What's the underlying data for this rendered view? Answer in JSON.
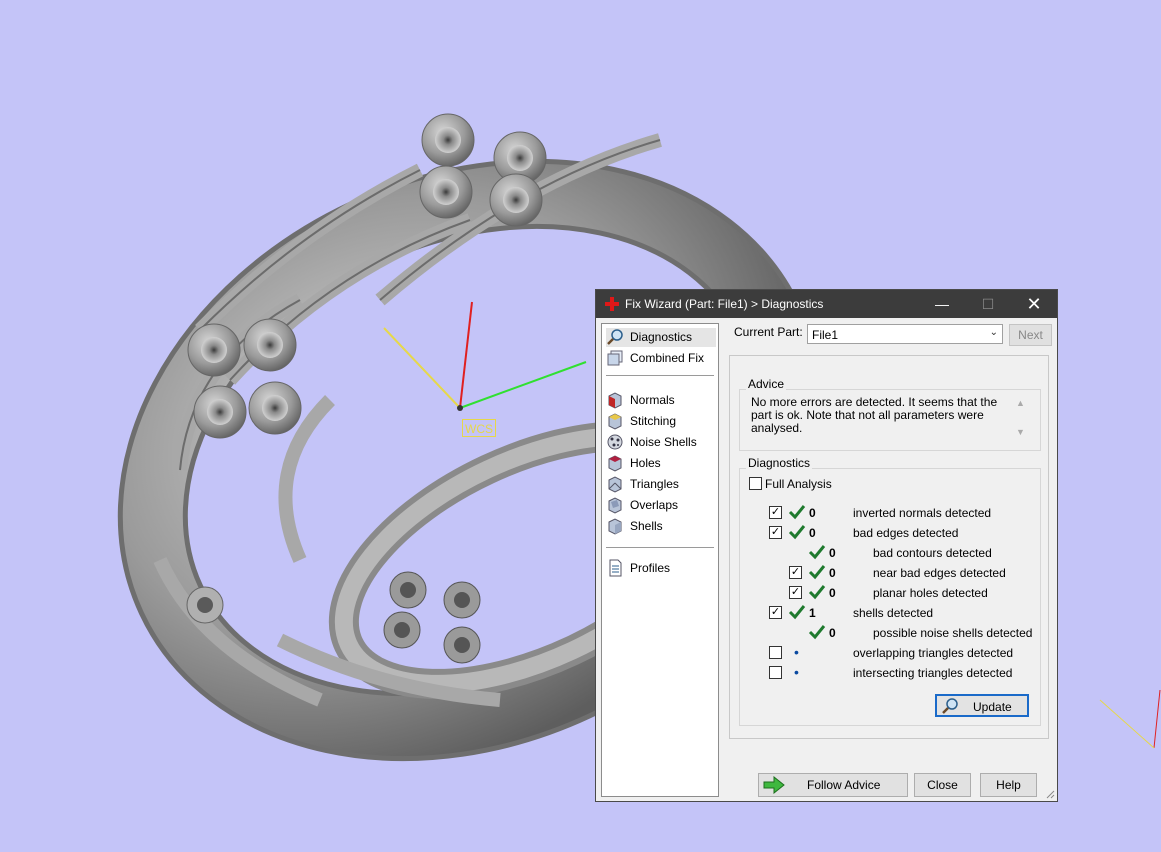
{
  "viewport": {
    "background": "#c4c4f8",
    "wcs_label": "WCS",
    "axis_colors": {
      "x": "#30e030",
      "y": "#e6d84a",
      "z": "#e02020"
    }
  },
  "dialog": {
    "title": "Fix Wizard (Part: File1) > Diagnostics",
    "window_controls": {
      "minimize": "—",
      "maximize": "☐",
      "close": "✕"
    },
    "nav": {
      "top": [
        {
          "label": "Diagnostics",
          "icon": "magnifier-icon",
          "selected": true
        },
        {
          "label": "Combined Fix",
          "icon": "stack-icon"
        }
      ],
      "tools": [
        {
          "label": "Normals",
          "icon": "normals-icon"
        },
        {
          "label": "Stitching",
          "icon": "stitching-icon"
        },
        {
          "label": "Noise Shells",
          "icon": "noise-shells-icon"
        },
        {
          "label": "Holes",
          "icon": "holes-icon"
        },
        {
          "label": "Triangles",
          "icon": "triangles-icon"
        },
        {
          "label": "Overlaps",
          "icon": "overlaps-icon"
        },
        {
          "label": "Shells",
          "icon": "shells-icon"
        }
      ],
      "bottom": [
        {
          "label": "Profiles",
          "icon": "document-icon"
        }
      ]
    },
    "current_part": {
      "label": "Current Part:",
      "value": "File1"
    },
    "next_label": "Next",
    "advice": {
      "title": "Advice",
      "text": "No more errors are detected. It seems that the part is ok. Note that not all parameters were analysed."
    },
    "diagnostics": {
      "title": "Diagnostics",
      "full_analysis_label": "Full Analysis",
      "rows": [
        {
          "checkbox": true,
          "status": "check",
          "count": "0",
          "label": "inverted normals detected",
          "indent": 0
        },
        {
          "checkbox": true,
          "status": "check",
          "count": "0",
          "label": "bad edges detected",
          "indent": 0
        },
        {
          "checkbox": null,
          "status": "check",
          "count": "0",
          "label": "bad contours detected",
          "indent": 1
        },
        {
          "checkbox": true,
          "status": "check",
          "count": "0",
          "label": "near bad edges detected",
          "indent": 1
        },
        {
          "checkbox": true,
          "status": "check",
          "count": "0",
          "label": "planar holes detected",
          "indent": 1
        },
        {
          "checkbox": true,
          "status": "check",
          "count": "1",
          "label": "shells detected",
          "indent": 0
        },
        {
          "checkbox": null,
          "status": "check",
          "count": "0",
          "label": "possible noise shells detected",
          "indent": 1
        },
        {
          "checkbox": false,
          "status": "dot",
          "count": "",
          "label": "overlapping triangles detected",
          "indent": 0
        },
        {
          "checkbox": false,
          "status": "dot",
          "count": "",
          "label": "intersecting triangles detected",
          "indent": 0
        }
      ],
      "update_label": "Update"
    },
    "buttons": {
      "follow_advice": "Follow Advice",
      "close": "Close",
      "help": "Help"
    },
    "colors": {
      "titlebar": "#3c3c3c",
      "tick": "#1f7a2e",
      "accent": "#1a6ac9"
    }
  }
}
